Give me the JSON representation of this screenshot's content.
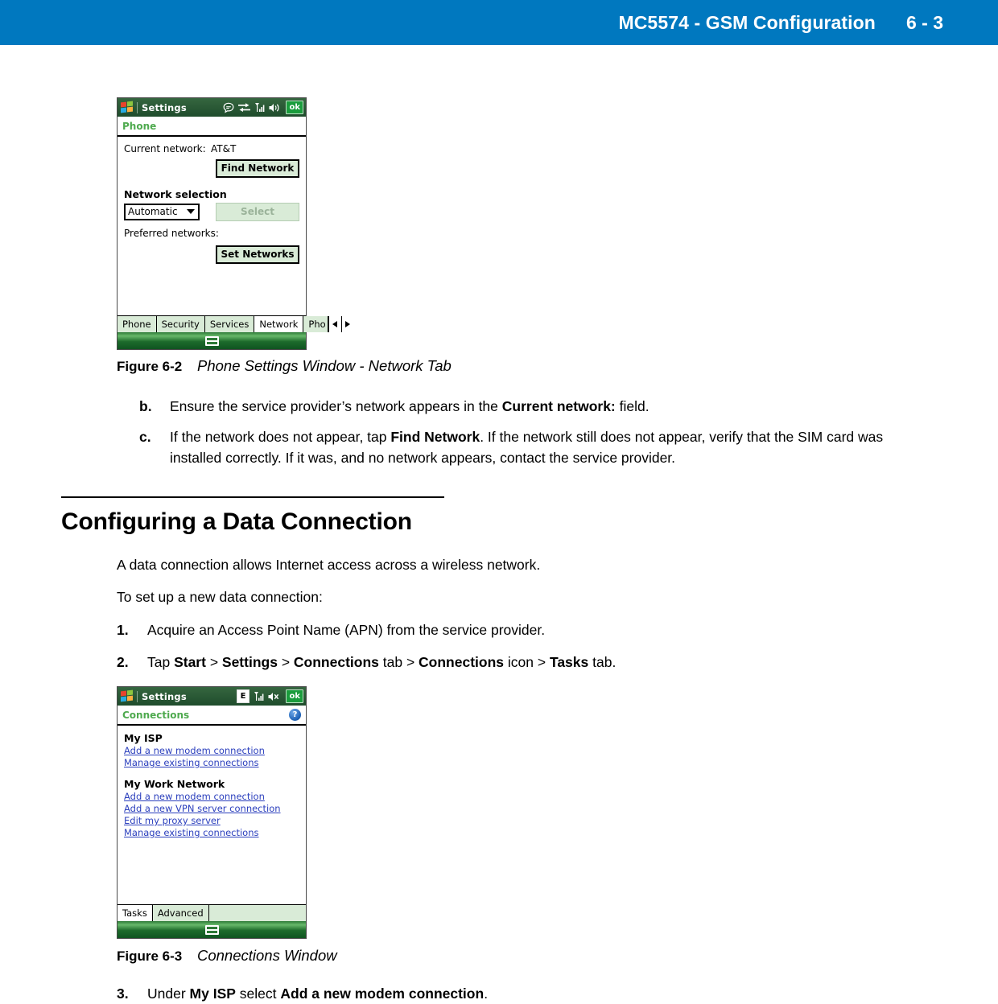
{
  "header": {
    "title": "MC5574 - GSM Configuration",
    "page_number": "6 - 3"
  },
  "figure_2": {
    "caption_label": "Figure 6-2",
    "caption_text": "Phone Settings Window - Network Tab",
    "device": {
      "titlebar": {
        "app_name": "Settings",
        "ok_label": "ok",
        "tray_icons": [
          "notification-bubble-icon",
          "connectivity-icon",
          "signal-bars-icon",
          "volume-icon"
        ]
      },
      "subheader": {
        "title": "Phone"
      },
      "current_network_label": "Current network:",
      "current_network_value": "AT&T",
      "find_network_button": "Find Network",
      "network_selection_label": "Network selection",
      "network_selection_value": "Automatic",
      "select_button": "Select",
      "preferred_networks_label": "Preferred networks:",
      "set_networks_button": "Set Networks",
      "tabs": [
        {
          "label": "Phone",
          "active": false
        },
        {
          "label": "Security",
          "active": false
        },
        {
          "label": "Services",
          "active": false
        },
        {
          "label": "Network",
          "active": true
        },
        {
          "label": "Pho",
          "active": false
        }
      ]
    }
  },
  "body": {
    "step_b": {
      "marker": "b.",
      "text_1": "Ensure the service provider’s network appears in the ",
      "bold_1": "Current network:",
      "text_2": " field."
    },
    "step_c": {
      "marker": "c.",
      "text_1": "If the network does not appear, tap ",
      "bold_1": "Find Network",
      "text_2": ". If the network still does not appear, verify that the SIM card was installed correctly. If it was, and no network appears, contact the service provider."
    },
    "section_title": "Configuring a Data Connection",
    "intro_1": "A data connection allows Internet access across a wireless network.",
    "intro_2": "To set up a new data connection:",
    "step_1": {
      "marker": "1.",
      "text": "Acquire an Access Point Name (APN) from the service provider."
    },
    "step_2": {
      "marker": "2.",
      "t1": "Tap ",
      "b1": "Start",
      "t2": " > ",
      "b2": "Settings",
      "t3": " > ",
      "b3": "Connections",
      "t4": " tab > ",
      "b4": "Connections",
      "t5": " icon > ",
      "b5": "Tasks",
      "t6": " tab."
    },
    "step_3": {
      "marker": "3.",
      "t1": "Under ",
      "b1": "My ISP",
      "t2": " select ",
      "b2": "Add a new modem connection",
      "t3": "."
    }
  },
  "figure_3": {
    "caption_label": "Figure 6-3",
    "caption_text": "Connections Window",
    "device": {
      "titlebar": {
        "app_name": "Settings",
        "ok_label": "ok",
        "edge_badge": "E",
        "tray_icons": [
          "edge-indicator-icon",
          "signal-bars-icon",
          "volume-muted-icon"
        ]
      },
      "subheader": {
        "title": "Connections",
        "help_label": "?"
      },
      "groups": [
        {
          "title": "My ISP",
          "links": [
            "Add a new modem connection",
            "Manage existing connections"
          ]
        },
        {
          "title": "My Work Network",
          "links": [
            "Add a new modem connection",
            "Add a new VPN server connection",
            "Edit my proxy server",
            "Manage existing connections"
          ]
        }
      ],
      "tabs": [
        {
          "label": "Tasks",
          "active": true
        },
        {
          "label": "Advanced",
          "active": false
        }
      ]
    }
  },
  "colors": {
    "header_blue": "#0078bf",
    "titlebar_green": "#2c5c3b",
    "subheader_green": "#4faa4f",
    "button_green": "#d9ebd7",
    "link_blue": "#2b3fbd",
    "ok_green": "#1a9c3c"
  }
}
